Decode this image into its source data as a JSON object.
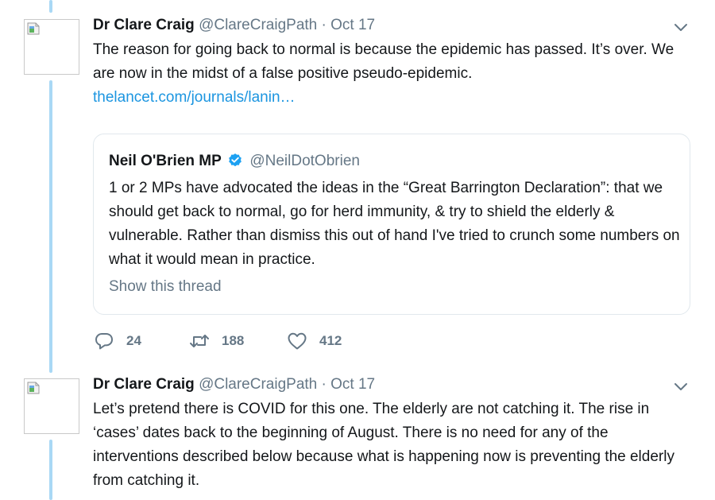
{
  "tweets": [
    {
      "author_name": "Dr Clare Craig",
      "handle": "@ClareCraigPath",
      "separator": "·",
      "date": "Oct 17",
      "text": "The reason for going back to normal is because the epidemic has passed. It’s over. We are now in the midst of a false positive pseudo-epidemic.",
      "link": "thelancet.com/journals/lanin…",
      "quote": {
        "author_name": "Neil O'Brien MP",
        "handle": "@NeilDotObrien",
        "text": "1 or 2 MPs have advocated the ideas in the “Great Barrington Declaration”: that we should get back to normal, go for herd immunity, & try to shield the elderly & vulnerable. Rather than dismiss this out of hand I've tried to crunch some numbers on what it would mean in practice.",
        "show_thread": "Show this thread"
      },
      "replies": "24",
      "retweets": "188",
      "likes": "412"
    },
    {
      "author_name": "Dr Clare Craig",
      "handle": "@ClareCraigPath",
      "separator": "·",
      "date": "Oct 17",
      "text": "Let’s pretend there is COVID for this one. The elderly are not catching it. The rise in ‘cases’ dates back to the beginning of August. There is no need for any of the interventions described below because what is happening now is preventing the elderly from catching it."
    }
  ],
  "colors": {
    "thread_line": "#a9d8f5",
    "link": "#1b95e0",
    "secondary_text": "#657786",
    "verified": "#1da1f2"
  },
  "icons": {
    "reply": "reply-icon",
    "retweet": "retweet-icon",
    "like": "heart-icon",
    "more": "chevron-down-icon",
    "verified": "verified-badge-icon",
    "avatar": "broken-image-icon"
  }
}
